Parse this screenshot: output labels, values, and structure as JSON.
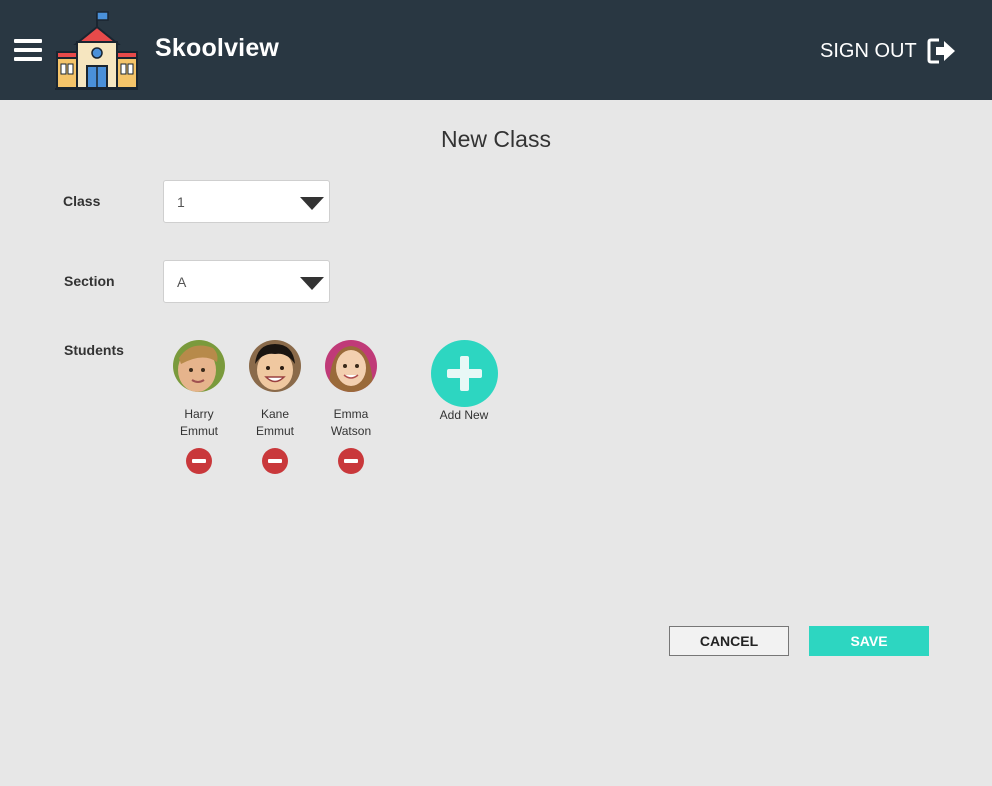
{
  "header": {
    "title": "Skoolview",
    "signout_label": "SIGN OUT",
    "background": "#293742"
  },
  "page": {
    "title": "New Class"
  },
  "form": {
    "class_label": "Class",
    "class_value": "1",
    "section_label": "Section",
    "section_value": "A",
    "students_label": "Students"
  },
  "students": [
    {
      "first": "Harry",
      "last": "Emmut"
    },
    {
      "first": "Kane",
      "last": "Emmut"
    },
    {
      "first": "Emma",
      "last": "Watson"
    }
  ],
  "add_new_label": "Add New",
  "actions": {
    "cancel_label": "CANCEL",
    "save_label": "SAVE"
  },
  "colors": {
    "accent": "#2dd6c1",
    "danger": "#c9383b",
    "background": "#e7e7e7"
  }
}
